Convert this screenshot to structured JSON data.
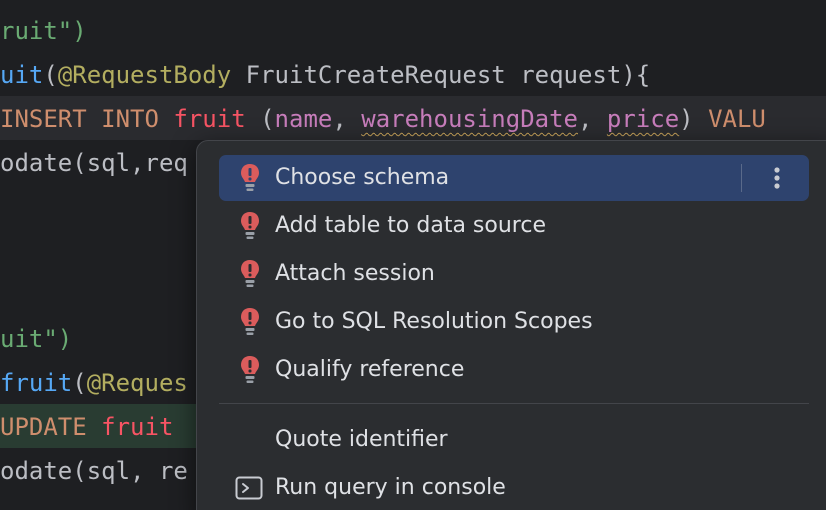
{
  "editor": {
    "lines": [
      {
        "parts": [
          {
            "t": "ruit",
            "c": "c-str"
          },
          {
            "t": "\")",
            "c": "c-str"
          }
        ]
      },
      {
        "parts": [
          {
            "t": "uit",
            "c": "c-fn"
          },
          {
            "t": "(",
            "c": "c-def"
          },
          {
            "t": "@RequestBody",
            "c": "c-ann"
          },
          {
            "t": " FruitCreateRequest request){",
            "c": "c-def"
          }
        ]
      },
      {
        "parts": [
          {
            "t": "INSERT INTO ",
            "c": "c-kw"
          },
          {
            "t": "fruit",
            "c": "c-tbl"
          },
          {
            "t": " (",
            "c": "c-def"
          },
          {
            "t": "name",
            "c": "c-col"
          },
          {
            "t": ", ",
            "c": "c-def"
          },
          {
            "t": "warehousingDate",
            "c": "c-col"
          },
          {
            "t": ", ",
            "c": "c-def"
          },
          {
            "t": "price",
            "c": "c-col"
          },
          {
            "t": ") ",
            "c": "c-def"
          },
          {
            "t": "VALU",
            "c": "c-kw"
          }
        ]
      },
      {
        "parts": [
          {
            "t": "odate(sql,req",
            "c": "c-def"
          }
        ]
      },
      {
        "parts": [
          {
            "t": "",
            "c": "c-def"
          }
        ]
      },
      {
        "parts": [
          {
            "t": "",
            "c": "c-def"
          }
        ]
      },
      {
        "parts": [
          {
            "t": "",
            "c": "c-def"
          }
        ]
      },
      {
        "parts": [
          {
            "t": "uit\")",
            "c": "c-str"
          }
        ]
      },
      {
        "parts": [
          {
            "t": "fruit",
            "c": "c-fn"
          },
          {
            "t": "(",
            "c": "c-def"
          },
          {
            "t": "@Reques",
            "c": "c-ann"
          }
        ]
      },
      {
        "parts": [
          {
            "t": "UPDATE ",
            "c": "c-kw"
          },
          {
            "t": "fruit",
            "c": "c-tbl"
          }
        ]
      },
      {
        "parts": [
          {
            "t": "odate(sql, re",
            "c": "c-def"
          }
        ]
      }
    ]
  },
  "popup": {
    "items": [
      {
        "label": "Choose schema",
        "icon": "red-bulb-icon",
        "selected": true
      },
      {
        "label": "Add table to data source",
        "icon": "red-bulb-icon"
      },
      {
        "label": "Attach session",
        "icon": "red-bulb-icon"
      },
      {
        "label": "Go to SQL Resolution Scopes",
        "icon": "red-bulb-icon"
      },
      {
        "label": "Qualify reference",
        "icon": "red-bulb-icon"
      },
      {
        "label": "Quote identifier",
        "icon": ""
      },
      {
        "label": "Run query in console",
        "icon": "console-icon"
      }
    ],
    "more_icon": "vertical-ellipsis-icon"
  },
  "colors": {
    "background": "#1e1f22",
    "popup_bg": "#2b2d30",
    "selected_bg": "#2e436e",
    "bulb_red": "#db5c5c"
  }
}
